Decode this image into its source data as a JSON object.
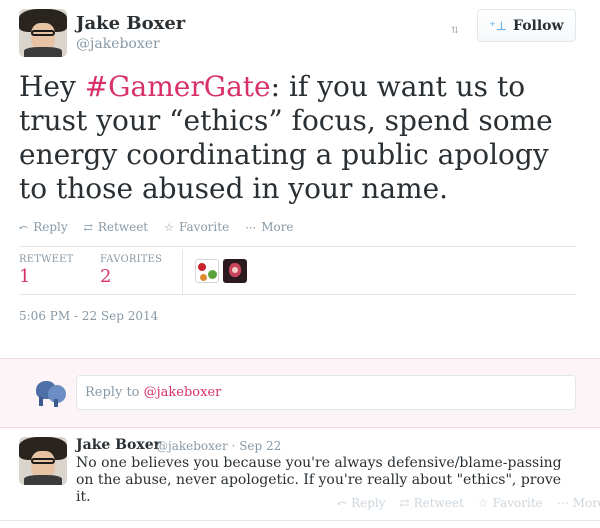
{
  "user": {
    "name": "Jake Boxer",
    "handle": "@jakeboxer"
  },
  "header": {
    "expand_icon": "⇅",
    "follow_label": "Follow",
    "follow_icon": "follow-plus-icon"
  },
  "tweet": {
    "text_before": "Hey ",
    "hashtag": "#GamerGate",
    "text_after": ": if you want us to trust your “ethics” focus, spend some energy coordinating a public apology to those abused in your name.",
    "timestamp": "5:06 PM - 22 Sep 2014"
  },
  "actions": {
    "reply": "Reply",
    "retweet": "Retweet",
    "favorite": "Favorite",
    "more": "More"
  },
  "stats": {
    "retweet_label": "RETWEET",
    "retweet_count": "1",
    "favorites_label": "FAVORITES",
    "favorites_count": "2"
  },
  "reply_box": {
    "prefix": "Reply to ",
    "mention": "@jakeboxer"
  },
  "reply": {
    "name": "Jake Boxer",
    "meta": "@jakeboxer · Sep 22",
    "text": "No one believes you because you're always defensive/blame-passing on the abuse, never apologetic. If you're really about \"ethics\", prove it.",
    "actions": {
      "reply": "Reply",
      "retweet": "Retweet",
      "favorite": "Favorite",
      "more": "More"
    }
  },
  "colors": {
    "accent": "#d8306a",
    "muted": "#8899a6",
    "text": "#292f33",
    "reply_bg": "#fcf4f6"
  }
}
